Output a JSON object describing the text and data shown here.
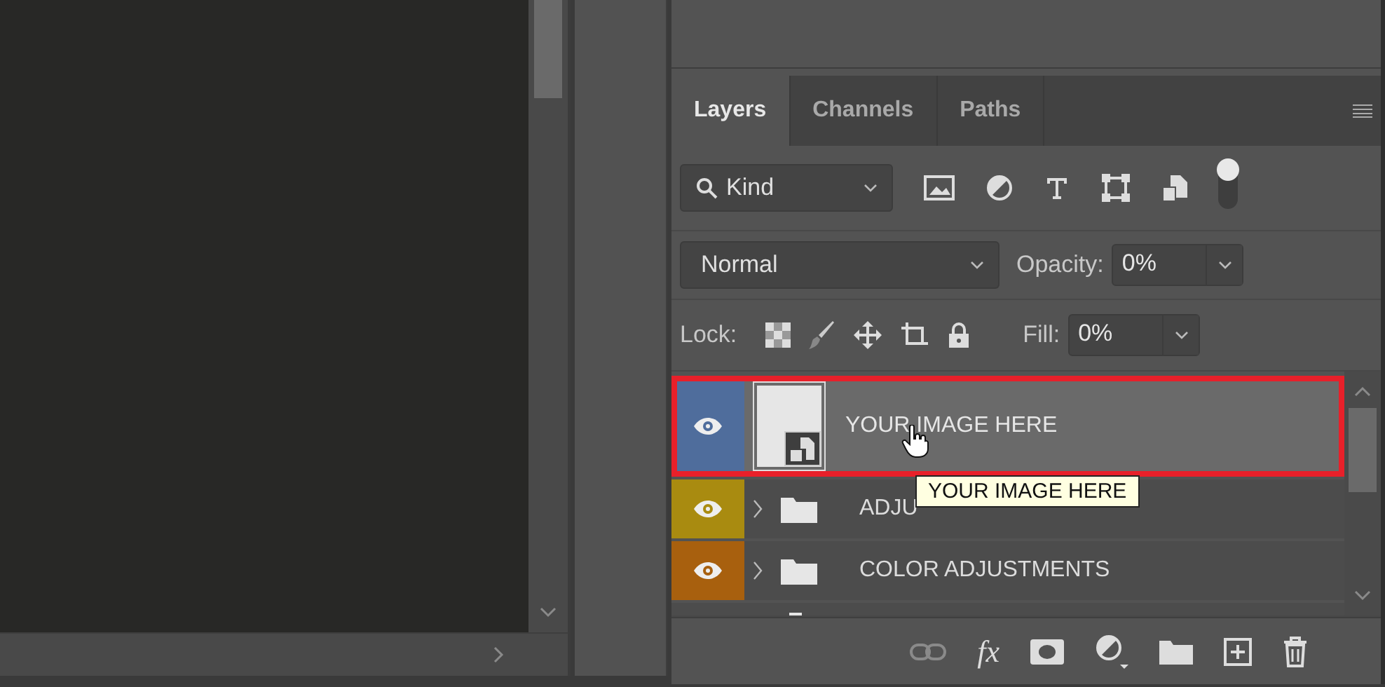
{
  "tabs": [
    {
      "label": "Layers",
      "selected": true
    },
    {
      "label": "Channels",
      "selected": false
    },
    {
      "label": "Paths",
      "selected": false
    }
  ],
  "filter": {
    "value": "Kind",
    "toggle_on": true
  },
  "blend": {
    "mode": "Normal",
    "opacity_label": "Opacity:",
    "opacity": "0%"
  },
  "lock": {
    "label": "Lock:",
    "fill_label": "Fill:",
    "fill": "0%"
  },
  "layers": [
    {
      "name": "YOUR IMAGE HERE",
      "kind": "smart-object",
      "color": "#4f6d9c",
      "visible": true,
      "selected": true,
      "highlighted": true
    },
    {
      "name": "ADJU",
      "kind": "group",
      "color": "#a98b10",
      "visible": true,
      "selected": false,
      "highlighted": false,
      "expanded": false
    },
    {
      "name": "COLOR ADJUSTMENTS",
      "kind": "group",
      "color": "#a8600e",
      "visible": true,
      "selected": false,
      "highlighted": false,
      "expanded": false
    }
  ],
  "tooltip": {
    "text": "YOUR IMAGE HERE"
  },
  "footer": {
    "fx": "fx"
  }
}
